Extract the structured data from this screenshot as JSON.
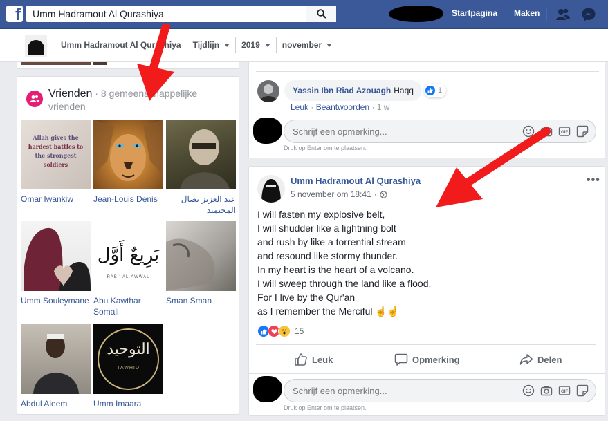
{
  "topbar": {
    "logo": "f",
    "search_value": "Umm Hadramout Al Qurashiya",
    "nav": [
      "Startpagina",
      "Maken"
    ]
  },
  "subbar": {
    "crumbs": [
      "Umm Hadramout Al Qurashiya",
      "Tijdlijn",
      "2019",
      "november"
    ]
  },
  "friends": {
    "title": "Vrienden",
    "subtitle": "· 8 gemeenschappelijke vrienden",
    "items": [
      {
        "name": "Omar Iwankiw"
      },
      {
        "name": "Jean-Louis Denis"
      },
      {
        "name": "عبد العزيز نضال المجيميد"
      },
      {
        "name": "Umm Souleymane"
      },
      {
        "name": "Abu Kawthar Somali"
      },
      {
        "name": "Sman Sman"
      },
      {
        "name": "Abdul Aleem"
      },
      {
        "name": "Umm Imaara"
      }
    ],
    "first_pic_text": [
      "Allah gives the",
      "hardest battles to",
      "the strongest",
      "soldiers"
    ],
    "calligraphy_text": "بَرِيعٌ أَوَّل",
    "calligraphy_caption": "RABI' AL-AWWAL",
    "tawheed_text": "التوحيد",
    "tawheed_caption": "TAWHID"
  },
  "comment": {
    "author": "Yassin Ibn Riad Azouagh",
    "text": "Haqq",
    "like_count": "1",
    "actions": [
      "Leuk",
      "Beantwoorden"
    ],
    "time": "1 w"
  },
  "composer": {
    "placeholder": "Schrijf een opmerking...",
    "hint": "Druk op Enter om te plaatsen.",
    "icons": [
      "emoji-icon",
      "camera-icon",
      "gif-icon",
      "sticker-icon"
    ]
  },
  "post": {
    "author": "Umm Hadramout Al Qurashiya",
    "time": "5 november om 18:41",
    "menu": "•••",
    "lines": [
      "I will fasten my explosive belt,",
      "I will shudder like a lightning bolt",
      "and rush by like a torrential stream",
      "and resound like stormy thunder.",
      "In my heart is the heart of a volcano.",
      "I will sweep through the land like a flood.",
      "For I live by the Qur'an",
      "as I remember the Merciful ☝☝"
    ],
    "reaction_count": "15",
    "actions": [
      "Leuk",
      "Opmerking",
      "Delen"
    ]
  },
  "colors": {
    "brand": "#3b5998",
    "link": "#365899",
    "annotation_arrow": "#f21b1b"
  }
}
